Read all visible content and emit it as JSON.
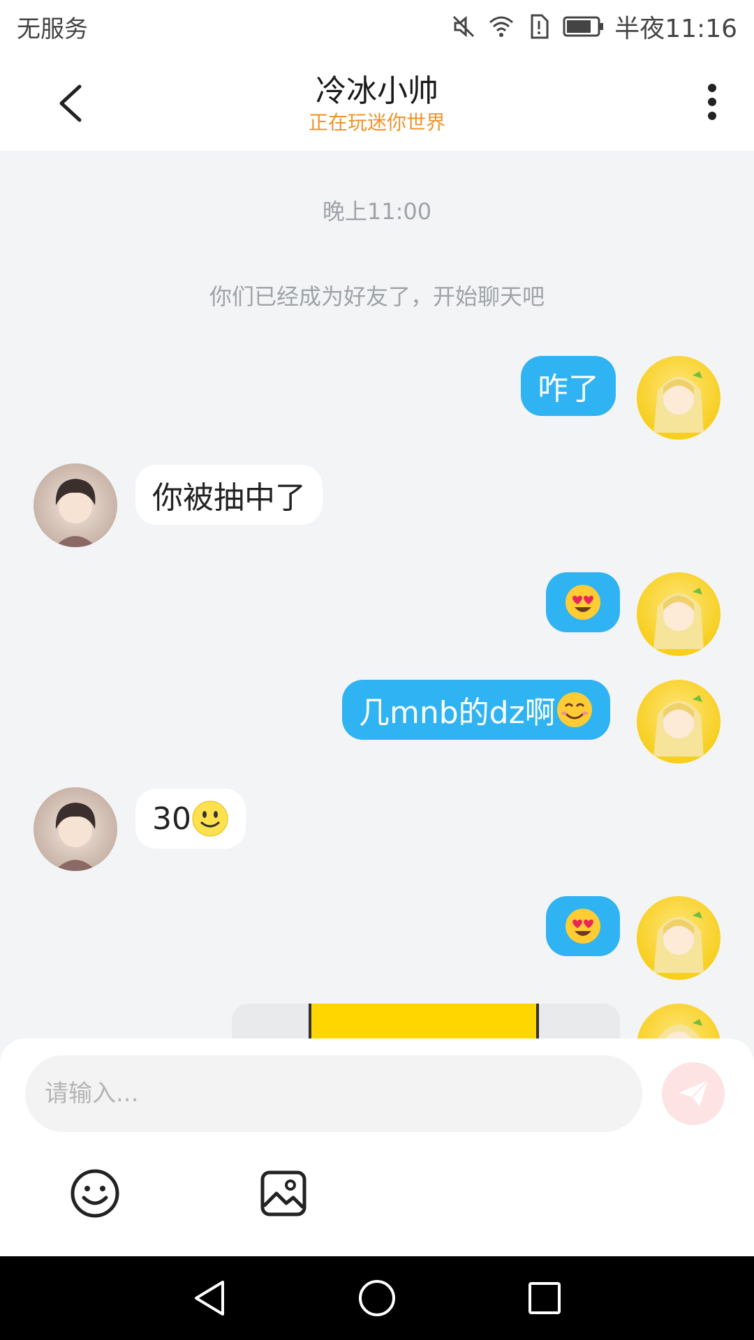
{
  "status_bar": {
    "carrier": "无服务",
    "time": "半夜11:16"
  },
  "header": {
    "title": "冷冰小帅",
    "subtitle": "正在玩迷你世界"
  },
  "chat": {
    "timestamp": "晚上11:00",
    "system_message": "你们已经成为好友了，开始聊天吧",
    "messages": [
      {
        "side": "out",
        "text": "咋了"
      },
      {
        "side": "in",
        "text": "你被抽中了"
      },
      {
        "side": "out",
        "emoji": "heart-eyes"
      },
      {
        "side": "out",
        "text": "几mnb的dz啊",
        "emoji": "smiling-face"
      },
      {
        "side": "in",
        "text": "30",
        "emoji": "slight-smile"
      },
      {
        "side": "out",
        "emoji": "heart-eyes"
      },
      {
        "side": "out",
        "image": "partially visible yellow card image"
      }
    ]
  },
  "input": {
    "placeholder": "请输入..."
  },
  "colors": {
    "accent": "#2fb3f2",
    "subtitle": "#f0932b",
    "send_button": "#fde3e3"
  }
}
